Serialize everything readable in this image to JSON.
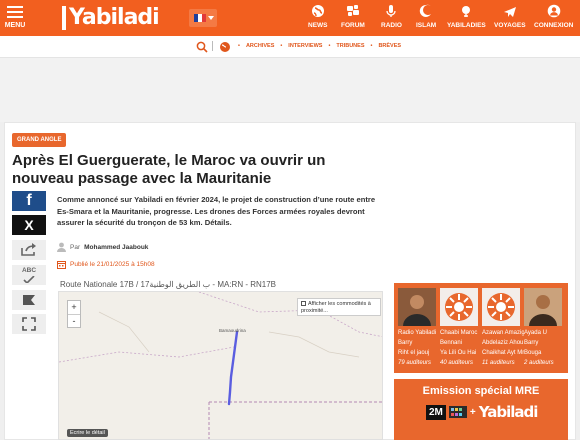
{
  "header": {
    "menu_label": "MENU",
    "logo_text": "Yabiladi",
    "nav": [
      {
        "label": "NEWS",
        "icon": "globe-icon"
      },
      {
        "label": "FORUM",
        "icon": "forum-icon"
      },
      {
        "label": "RADIO",
        "icon": "microphone-icon"
      },
      {
        "label": "ISLAM",
        "icon": "islam-icon"
      },
      {
        "label": "YABILADIES",
        "icon": "yabiladies-icon"
      },
      {
        "label": "VOYAGES",
        "icon": "plane-icon"
      },
      {
        "label": "CONNEXION",
        "icon": "user-icon"
      }
    ]
  },
  "subnav": {
    "links": [
      "ARCHIVES",
      "INTERVIEWS",
      "TRIBUNES",
      "BRÈVES"
    ]
  },
  "article": {
    "category": "GRAND ANGLE",
    "title": "Après El Guerguerate, le Maroc va ouvrir un nouveau passage avec la Mauritanie",
    "lead": "Comme annoncé sur Yabiladi en février 2024, le projet de construction d’une route entre Es-Smara et la Mauritanie, progresse. Les drones des Forces armées royales devront assurer la sécurité du tronçon de 53 km. Détails.",
    "author_prefix": "Par",
    "author": "Mohammed Jaabouk",
    "published": "Publié le 21/01/2025 à 15h08",
    "share": {
      "facebook": "f",
      "x": "X",
      "abc": "ABC"
    }
  },
  "map": {
    "title": "Route Nationale 17B / 17ب الطريق الوطنية - MA:RN - RN17B",
    "zoom_in": "+",
    "zoom_out": "-",
    "option_label": "Afficher les commodités à proximité...",
    "place_label": "Bamaoudrina",
    "link_label": "Ecrire le détail"
  },
  "radio": {
    "stations": [
      {
        "name": "Radio Yabiladi",
        "host": "Barry",
        "track": "Riht el jaouj",
        "listeners": "79 auditeurs"
      },
      {
        "name": "Chaabi Maroc",
        "host": "Bennani",
        "track": "Ya Lili Ou Hai",
        "listeners": "40 auditeurs"
      },
      {
        "name": "Azawan Amazigh",
        "host": "Abdelaziz Ahou",
        "track": "Chaikhat Ayt Mr",
        "listeners": "11 auditeurs"
      },
      {
        "name": "Ayada U",
        "host": "Barry",
        "track": "Bouga",
        "listeners": "2 auditeurs"
      }
    ]
  },
  "promo": {
    "title": "Emission spécial MRE",
    "channel": "2M",
    "plus": "+",
    "logo_text": "Yabiladi"
  },
  "colors": {
    "brand_orange": "#f25f1f",
    "facebook_blue": "#1f4d8a",
    "route_blue": "#5a5de0"
  }
}
